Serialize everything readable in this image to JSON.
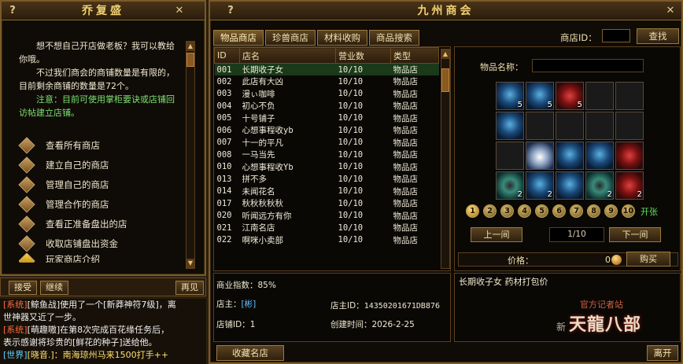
{
  "left_window": {
    "title": "乔复盛",
    "help": "?",
    "close": "✕",
    "intro_lines": [
      "想不想自己开店做老板？我可以",
      "教给你哦。",
      "不过我们商会的商铺数量是有限的，",
      "的，目前剩余商铺的数量是72个。"
    ],
    "intro_text_1": "想不想自己开店做老板？我可以教给你哦。",
    "intro_text_2": "不过我们商会的商铺数量是有限的，目前剩余商铺的数量是72个。",
    "notice": "注意：目前可使用掌柜要诀或店铺回访帖建立店铺。",
    "menu": [
      {
        "label": "查看所有商店"
      },
      {
        "label": "建立自己的商店"
      },
      {
        "label": "管理自己的商店"
      },
      {
        "label": "管理合作的商店"
      },
      {
        "label": "查看正准备盘出的店"
      },
      {
        "label": "收取店铺盘出资金"
      },
      {
        "label": "玩家商店介绍"
      }
    ],
    "buttons": {
      "accept": "接受",
      "continue": "继续",
      "goodbye": "再见"
    }
  },
  "chat": [
    {
      "tag": "[系统]",
      "text": "[鲸鱼战]使用了一个[新莽神符7级]，离"
    },
    {
      "tag": "",
      "text": "世神器又近了一步。"
    },
    {
      "tag": "[系统]",
      "text": "[萌趣嗷]在第8次完成百花缘任务后，"
    },
    {
      "tag": "",
      "text": "表示感谢将珍贵的[鲜花的种子]送给他。"
    },
    {
      "tag": "[世界]",
      "text": "[晓音.]：南海琼州马来1500打手++"
    }
  ],
  "main_window": {
    "title": "九州商会",
    "help": "?",
    "close": "✕",
    "tabs": [
      "物品商店",
      "珍兽商店",
      "材料收购",
      "商品搜索"
    ],
    "active_tab": 0,
    "shop_id_label": "商店ID：",
    "find_button": "查找",
    "table_headers": [
      "ID",
      "店名",
      "营业数",
      "类型"
    ],
    "rows": [
      [
        "001",
        "长期收子女",
        "10/10",
        "物品店"
      ],
      [
        "002",
        "此店有大凶",
        "10/10",
        "物品店"
      ],
      [
        "003",
        "漫ぃ咖啡",
        "10/10",
        "物品店"
      ],
      [
        "004",
        "初心不负",
        "10/10",
        "物品店"
      ],
      [
        "005",
        "十号铺子",
        "10/10",
        "物品店"
      ],
      [
        "006",
        "心想事程收yb",
        "10/10",
        "物品店"
      ],
      [
        "007",
        "十一的平凡",
        "10/10",
        "物品店"
      ],
      [
        "008",
        "一马当先",
        "10/10",
        "物品店"
      ],
      [
        "010",
        "心想事程收Yb",
        "10/10",
        "物品店"
      ],
      [
        "013",
        "拼不多",
        "10/10",
        "物品店"
      ],
      [
        "014",
        "未闻花名",
        "10/10",
        "物品店"
      ],
      [
        "017",
        "秋秋秋秋秋",
        "10/10",
        "物品店"
      ],
      [
        "020",
        "听闻远方有你",
        "10/10",
        "物品店"
      ],
      [
        "021",
        "江南名店",
        "10/10",
        "物品店"
      ],
      [
        "022",
        "啊咪小卖部",
        "10/10",
        "物品店"
      ]
    ],
    "selected_row": 0,
    "detail": {
      "business_index": "商业指数：85%",
      "owner_label": "店主：",
      "owner_name": "[彬]",
      "owner_id_label": "店主ID：",
      "owner_id": "14350201671DB876",
      "shop_id_label": "店铺ID：",
      "shop_id": "1",
      "created_label": "创建时间：",
      "created": "2026-2-25"
    },
    "item_name_label": "物品名称：",
    "slots": [
      {
        "type": "i",
        "qty": "5"
      },
      {
        "type": "i",
        "qty": "5"
      },
      {
        "type": "r",
        "qty": "5"
      },
      {
        "type": "",
        "qty": ""
      },
      {
        "type": "",
        "qty": ""
      },
      {
        "type": "i",
        "qty": ""
      },
      {
        "type": "",
        "qty": ""
      },
      {
        "type": "",
        "qty": ""
      },
      {
        "type": "",
        "qty": ""
      },
      {
        "type": "",
        "qty": ""
      },
      {
        "type": "",
        "qty": ""
      },
      {
        "type": "b",
        "qty": ""
      },
      {
        "type": "i",
        "qty": ""
      },
      {
        "type": "i",
        "qty": ""
      },
      {
        "type": "r",
        "qty": ""
      },
      {
        "type": "e",
        "qty": "2"
      },
      {
        "type": "i",
        "qty": "2"
      },
      {
        "type": "i",
        "qty": ""
      },
      {
        "type": "e",
        "qty": "2"
      },
      {
        "type": "r",
        "qty": "2"
      }
    ],
    "pages": [
      "1",
      "2",
      "3",
      "4",
      "5",
      "6",
      "7",
      "8",
      "9",
      "10"
    ],
    "active_page": 0,
    "open_label": "开张",
    "prev_page": "上一间",
    "page_info": "1/10",
    "next_page": "下一间",
    "price_label": "价格：",
    "price_value": "0",
    "buy_button": "购买",
    "description": "长期收子女 药材打包价",
    "favorite_button": "收藏名店",
    "leave_button": "离开",
    "logo_small": "官方记者站",
    "logo_main": "天龍八部",
    "logo_prefix": "新"
  }
}
